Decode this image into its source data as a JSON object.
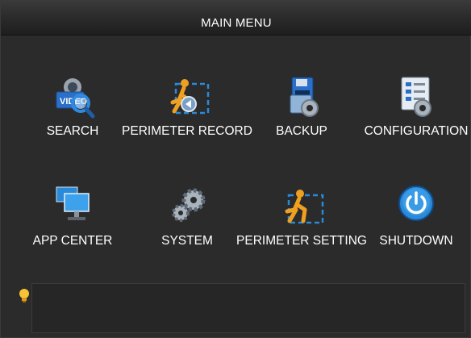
{
  "window": {
    "title": "MAIN MENU"
  },
  "menu": {
    "items": [
      {
        "label": "SEARCH",
        "icon": "search-video-icon"
      },
      {
        "label": "PERIMETER RECORD",
        "icon": "perimeter-record-icon"
      },
      {
        "label": "BACKUP",
        "icon": "backup-icon"
      },
      {
        "label": "CONFIGURATION",
        "icon": "configuration-icon"
      },
      {
        "label": "APP CENTER",
        "icon": "app-center-icon"
      },
      {
        "label": "SYSTEM",
        "icon": "system-gears-icon"
      },
      {
        "label": "PERIMETER SETTING",
        "icon": "perimeter-setting-icon"
      },
      {
        "label": "SHUTDOWN",
        "icon": "power-icon"
      }
    ]
  },
  "hint": {
    "icon": "lightbulb-icon",
    "text": ""
  },
  "colors": {
    "accent_orange": "#f0a020",
    "accent_blue": "#2a8ad8",
    "background": "#2b2b2b"
  }
}
